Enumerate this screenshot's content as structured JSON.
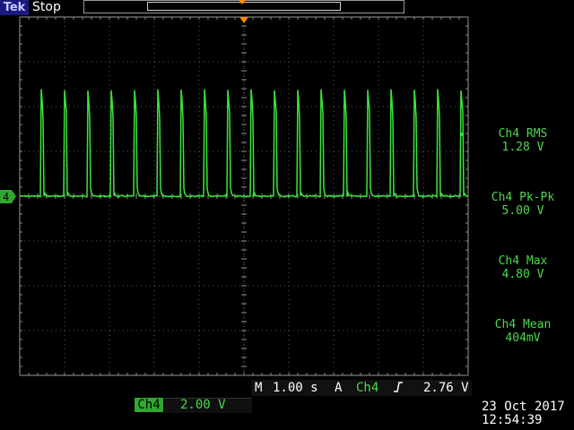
{
  "brand": "Tek",
  "status": "Stop",
  "channel_marker": "4",
  "measurements": [
    {
      "label": "Ch4 RMS",
      "value": "1.28 V"
    },
    {
      "label": "Ch4 Pk-Pk",
      "value": "5.00 V"
    },
    {
      "label": "Ch4 Max",
      "value": "4.80 V"
    },
    {
      "label": "Ch4 Mean",
      "value": "404mV"
    }
  ],
  "horizontal": {
    "prefix": "M",
    "value": "1.00 s"
  },
  "trigger": {
    "prefix": "A",
    "source": "Ch4",
    "slope_icon": "rising-edge-icon",
    "level": "2.76 V"
  },
  "channel": {
    "name": "Ch4",
    "scale": "2.00 V"
  },
  "date": "23 Oct  2017",
  "time": "12:54:39",
  "colors": {
    "trace": "#39e639",
    "accent": "#ff8a00",
    "grid": "#5a5a5a"
  },
  "waveform": {
    "baseline_v": 0.0,
    "peak_v": 5.0,
    "volts_per_div": 2.0,
    "seconds_per_div": 1.0,
    "pulse_period_s": 0.52,
    "pulse_width_s": 0.06
  }
}
